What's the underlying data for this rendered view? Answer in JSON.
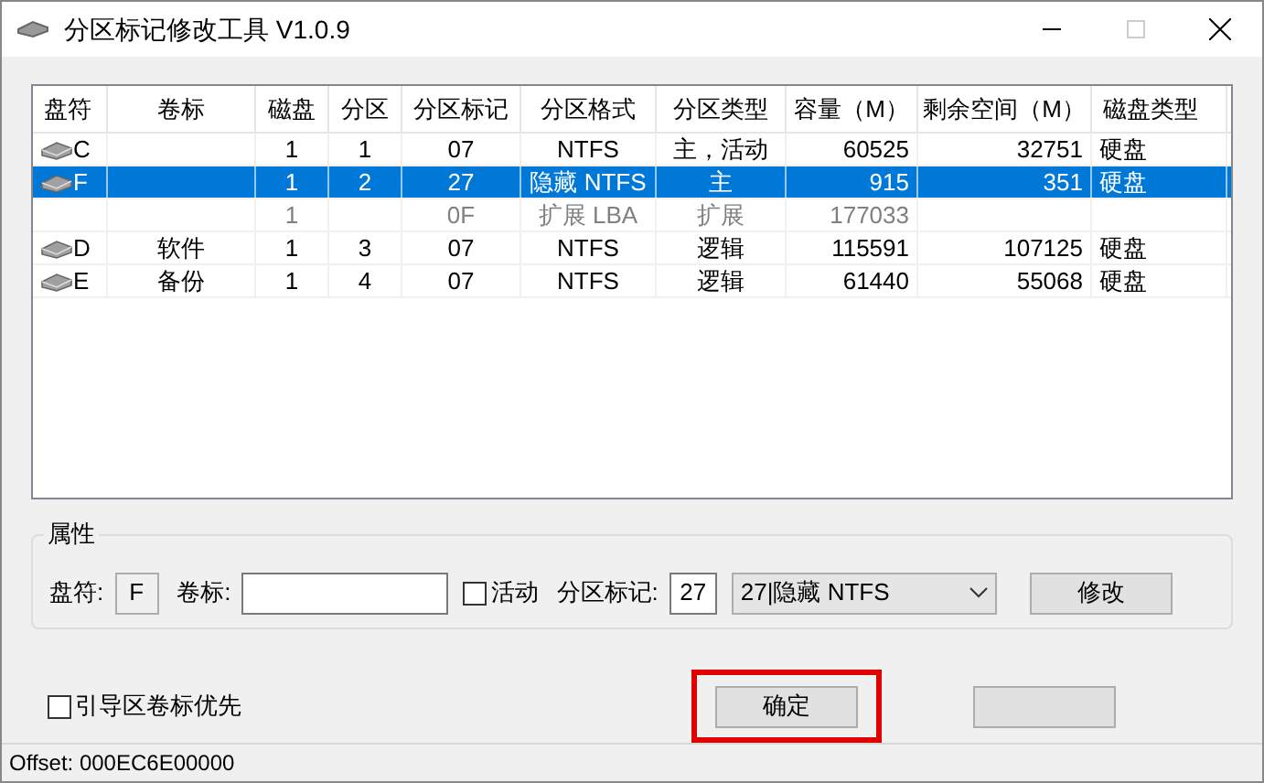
{
  "window": {
    "title": "分区标记修改工具 V1.0.9"
  },
  "table": {
    "columns": [
      "盘符",
      "卷标",
      "磁盘",
      "分区",
      "分区标记",
      "分区格式",
      "分区类型",
      "容量（M）",
      "剩余空间（M）",
      "磁盘类型"
    ],
    "rows": [
      {
        "kind": "drive",
        "selected": false,
        "cells": [
          "C",
          "",
          "1",
          "1",
          "07",
          "NTFS",
          "主，活动",
          "60525",
          "32751",
          "硬盘"
        ]
      },
      {
        "kind": "drive",
        "selected": true,
        "cells": [
          "F",
          "",
          "1",
          "2",
          "27",
          "隐藏 NTFS",
          "主",
          "915",
          "351",
          "硬盘"
        ]
      },
      {
        "kind": "extended",
        "selected": false,
        "cells": [
          "",
          "",
          "1",
          "",
          "0F",
          "扩展 LBA",
          "扩展",
          "177033",
          "",
          ""
        ]
      },
      {
        "kind": "drive",
        "selected": false,
        "cells": [
          "D",
          "软件",
          "1",
          "3",
          "07",
          "NTFS",
          "逻辑",
          "115591",
          "107125",
          "硬盘"
        ]
      },
      {
        "kind": "drive",
        "selected": false,
        "cells": [
          "E",
          "备份",
          "1",
          "4",
          "07",
          "NTFS",
          "逻辑",
          "61440",
          "55068",
          "硬盘"
        ]
      }
    ]
  },
  "properties": {
    "title": "属性",
    "drive_label": "盘符:",
    "drive_value": "F",
    "volume_label": "卷标:",
    "active": {
      "label": "活动",
      "checked": false
    },
    "flag_label": "分区标记:",
    "flag_value": "27",
    "flag_select": "27|隐藏 NTFS",
    "modify_button": "修改"
  },
  "boot_priority": {
    "label": "引导区卷标优先",
    "checked": false
  },
  "ok_button": {
    "label": "确定",
    "highlighted": true
  },
  "status_bar": "Offset: 000EC6E00000"
}
